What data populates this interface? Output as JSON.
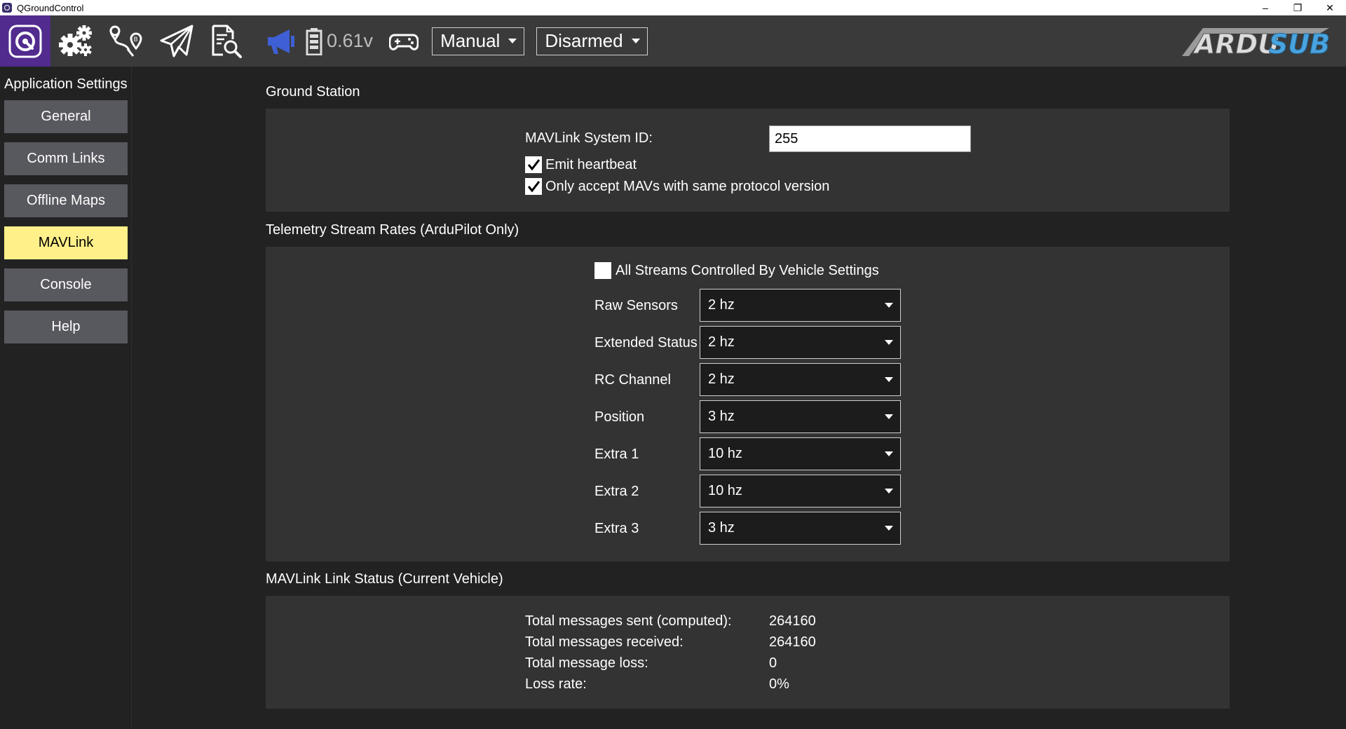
{
  "window": {
    "title": "QGroundControl",
    "controls": {
      "minimize": "–",
      "restore": "❐",
      "close": "✕"
    }
  },
  "toolbar": {
    "voltage": "0.61v",
    "flight_mode": "Manual",
    "arm_state": "Disarmed",
    "brand": {
      "part1": "ARDU",
      "part2": "SUB"
    },
    "icons": [
      "qgc-logo-icon",
      "gear-icon",
      "plan-route-icon",
      "fly-paper-plane-icon",
      "analyze-document-icon",
      "megaphone-icon",
      "battery-icon",
      "joystick-icon"
    ],
    "colors": {
      "logo_bg": "#522b8e",
      "megaphone": "#3f5fd6",
      "brand_blue": "#4aa3df"
    }
  },
  "sidebar": {
    "header": "Application Settings",
    "items": [
      {
        "label": "General",
        "active": false
      },
      {
        "label": "Comm Links",
        "active": false
      },
      {
        "label": "Offline Maps",
        "active": false
      },
      {
        "label": "MAVLink",
        "active": true
      },
      {
        "label": "Console",
        "active": false
      },
      {
        "label": "Help",
        "active": false
      }
    ],
    "active_color": "#fff08a"
  },
  "ground_station": {
    "title": "Ground Station",
    "system_id_label": "MAVLink System ID:",
    "system_id_value": "255",
    "emit_heartbeat": {
      "label": "Emit heartbeat",
      "checked": true
    },
    "same_protocol": {
      "label": "Only accept MAVs with same protocol version",
      "checked": true
    }
  },
  "telemetry": {
    "title": "Telemetry Stream Rates (ArduPilot Only)",
    "all_streams": {
      "label": "All Streams Controlled By Vehicle Settings",
      "checked": false
    },
    "rows": [
      {
        "label": "Raw Sensors",
        "value": "2 hz"
      },
      {
        "label": "Extended Status",
        "value": "2 hz"
      },
      {
        "label": "RC Channel",
        "value": "2 hz"
      },
      {
        "label": "Position",
        "value": "3 hz"
      },
      {
        "label": "Extra 1",
        "value": "10 hz"
      },
      {
        "label": "Extra 2",
        "value": "10 hz"
      },
      {
        "label": "Extra 3",
        "value": "3 hz"
      }
    ]
  },
  "link_status": {
    "title": "MAVLink Link Status (Current Vehicle)",
    "rows": [
      {
        "label": "Total messages sent (computed):",
        "value": "264160"
      },
      {
        "label": "Total messages received:",
        "value": "264160"
      },
      {
        "label": "Total message loss:",
        "value": "0"
      },
      {
        "label": "Loss rate:",
        "value": "0%"
      }
    ]
  }
}
